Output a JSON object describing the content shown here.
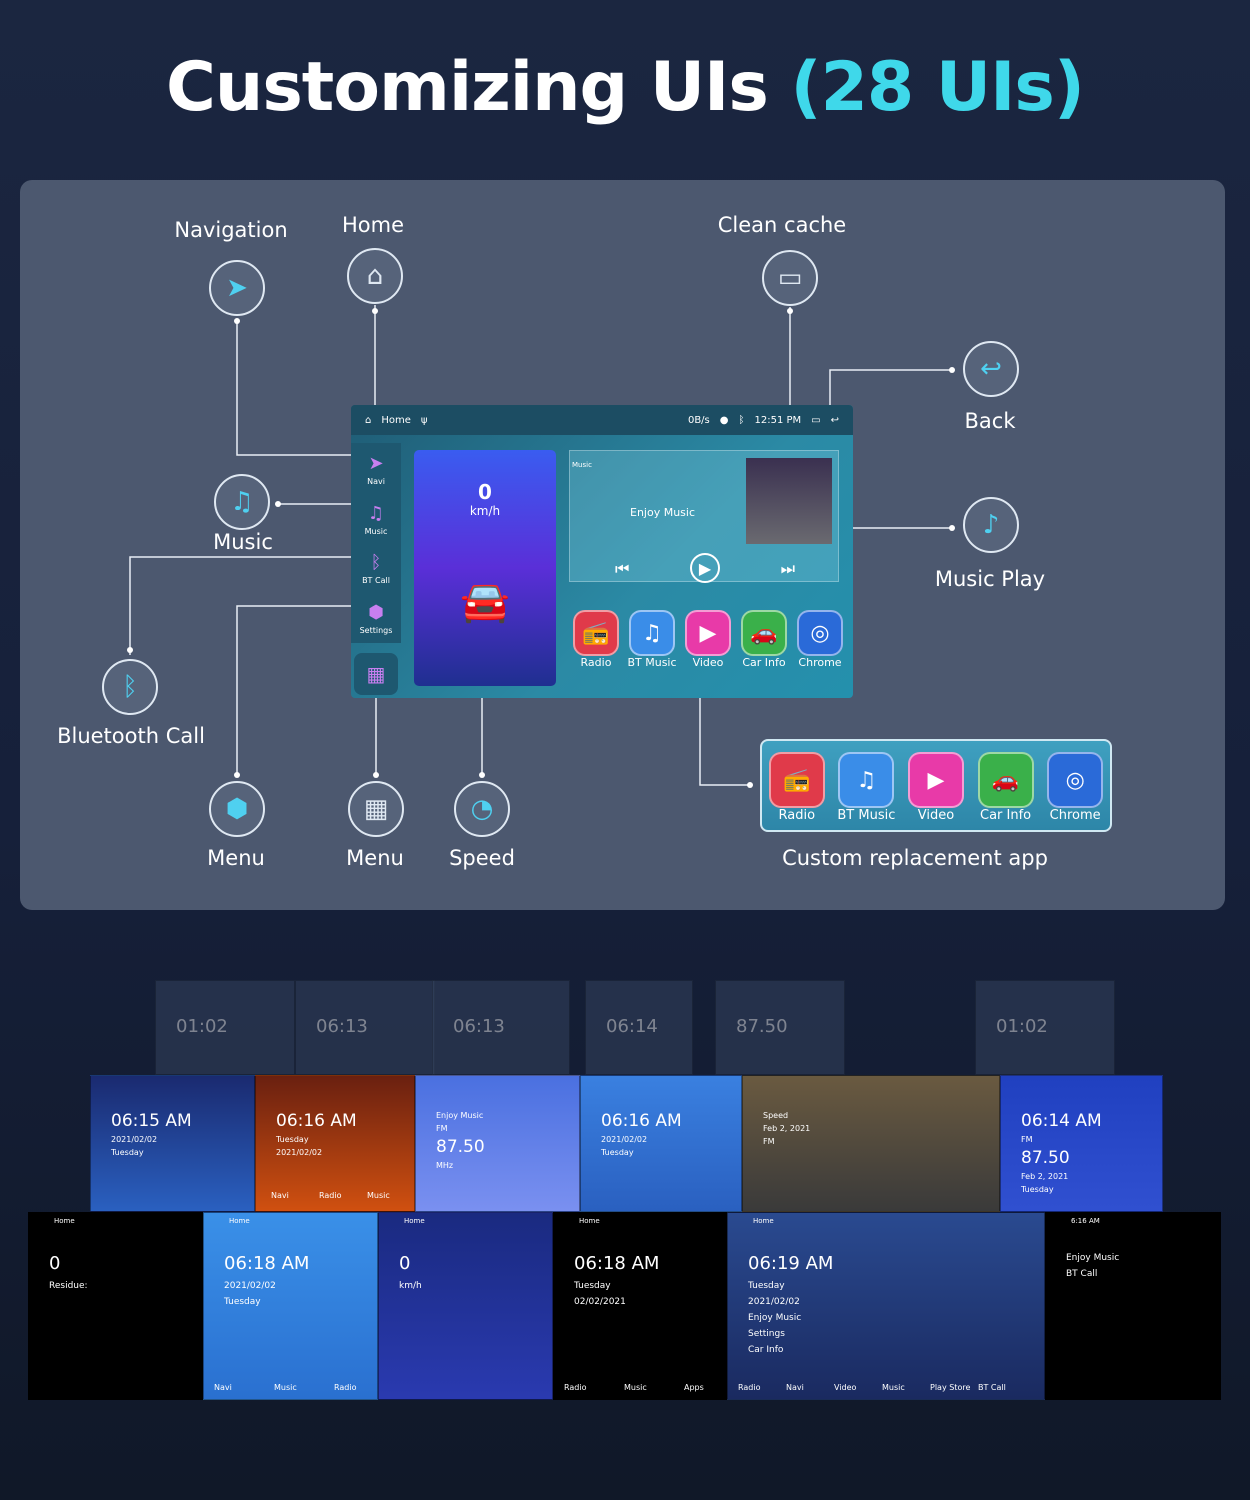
{
  "title": {
    "main": "Customizing UIs",
    "accent": "(28 UIs)"
  },
  "callouts": {
    "navigation": "Navigation",
    "home": "Home",
    "clean_cache": "Clean cache",
    "back": "Back",
    "music": "Music",
    "music_play": "Music Play",
    "bluetooth_call": "Bluetooth Call",
    "menu_left": "Menu",
    "menu_center": "Menu",
    "speed": "Speed",
    "custom_app": "Custom replacement app"
  },
  "screen": {
    "status": {
      "home": "Home",
      "net": "0B/s",
      "time": "12:51 PM"
    },
    "sidebar": [
      {
        "label": "Navi",
        "icon": "navigation-icon"
      },
      {
        "label": "Music",
        "icon": "music-note-icon"
      },
      {
        "label": "BT Call",
        "icon": "bluetooth-icon"
      },
      {
        "label": "Settings",
        "icon": "settings-icon"
      }
    ],
    "speed": {
      "value": "0",
      "unit": "km/h"
    },
    "music": {
      "header": "Music",
      "text": "Enjoy Music"
    },
    "apps": [
      {
        "label": "Radio",
        "icon": "radio-icon",
        "color": "#e03a4a"
      },
      {
        "label": "BT Music",
        "icon": "bt-music-icon",
        "color": "#3a8de8"
      },
      {
        "label": "Video",
        "icon": "video-icon",
        "color": "#e83aa8"
      },
      {
        "label": "Car Info",
        "icon": "car-icon",
        "color": "#3ab04a"
      },
      {
        "label": "Chrome",
        "icon": "chrome-icon",
        "color": "#2a6ad8"
      }
    ]
  },
  "colors": {
    "accent": "#3fd8ea",
    "panel": "#4c586f"
  },
  "collage": {
    "back": [
      "01:02",
      "06:13",
      "06:13",
      "06:14",
      "87.50",
      "01:02"
    ],
    "middle": [
      {
        "time": "06:15 AM",
        "date": "2021/02/02",
        "day": "Tuesday"
      },
      {
        "time": "06:16 AM",
        "day": "Tuesday",
        "date": "2021/02/02",
        "apps": [
          "Navi",
          "Radio",
          "Music"
        ]
      },
      {
        "label": "Enjoy Music",
        "band": "FM",
        "freq": "87.50",
        "unit": "MHz"
      },
      {
        "time": "06:16 AM",
        "date": "2021/02/02",
        "day": "Tuesday"
      },
      {
        "label": "Speed",
        "date": "Feb 2, 2021",
        "fm": "FM"
      },
      {
        "time": "06:14 AM",
        "band": "FM",
        "freq": "87.50",
        "date": "Feb 2, 2021",
        "day": "Tuesday"
      }
    ],
    "front": [
      {
        "home": "Home",
        "value": "0",
        "label": "Residue:"
      },
      {
        "home": "Home",
        "time": "06:18 AM",
        "date": "2021/02/02",
        "day": "Tuesday",
        "apps": [
          "Navi",
          "Music",
          "Radio"
        ]
      },
      {
        "home": "Home",
        "value": "0",
        "unit": "km/h"
      },
      {
        "home": "Home",
        "time": "06:18 AM",
        "day": "Tuesday",
        "date": "02/02/2021",
        "apps": [
          "Radio",
          "Music",
          "Apps"
        ]
      },
      {
        "home": "Home",
        "time": "06:19 AM",
        "day": "Tuesday",
        "date": "2021/02/02",
        "music": "Enjoy Music",
        "apps": [
          "Radio",
          "Navi",
          "Video",
          "Music",
          "Play Store",
          "BT Call"
        ],
        "settings": "Settings",
        "car": "Car Info"
      },
      {
        "status": "6:16 AM",
        "music": "Enjoy Music",
        "call": "BT Call"
      }
    ]
  }
}
